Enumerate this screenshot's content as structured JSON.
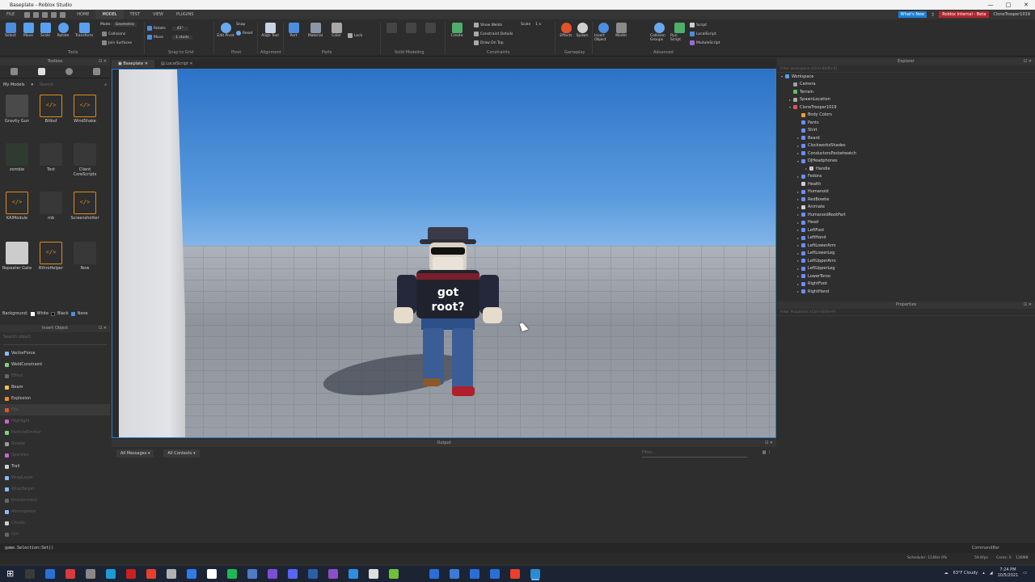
{
  "window": {
    "title": "Baseplate - Roblox Studio",
    "controls": [
      "—",
      "□",
      "✕"
    ]
  },
  "menubar": {
    "items": [
      "FILE",
      "HOME",
      "MODEL",
      "TEST",
      "VIEW",
      "PLUGINS"
    ],
    "active": "MODEL",
    "whats_new": "What's New",
    "internal_badge": "Roblox Internal - Beta",
    "user": "CloneTrooper1019"
  },
  "ribbon": {
    "tools": [
      "Select",
      "Move",
      "Scale",
      "Rotate",
      "Transform"
    ],
    "mode_label": "Mode:",
    "mode_value": "Geometric",
    "collisions": "Collisions",
    "join_surfaces": "Join Surfaces",
    "rotate_label": "Rotate",
    "rotate_value": "45°",
    "move_label": "Move",
    "move_value": "1 studs",
    "edit_pivot": "Edit Pivot",
    "snap_label": "Snap",
    "reset_label": "Reset",
    "align_tool": "Align Tool",
    "part": "Part",
    "material": "Material",
    "color": "Color",
    "lock": "Lock",
    "create": "Create",
    "show_welds": "Show Welds",
    "constraint_details": "Constraint Details",
    "draw_on_top": "Draw On Top",
    "scale_label": "Scale",
    "scale_value": "1 x",
    "effects": "Effects",
    "spawn": "Spawn",
    "insert_object": "Insert Object",
    "model": "Model",
    "collision_groups": "Collision Groups",
    "run_script": "Run Script",
    "script": "Script",
    "local_script": "LocalScript",
    "module_script": "ModuleScript",
    "groups": [
      "Tools",
      "Snap to Grid",
      "Pivot",
      "Alignment",
      "Parts",
      "Solid Modeling",
      "Constraints",
      "Gameplay",
      "Advanced"
    ]
  },
  "toolbox": {
    "title": "Toolbox",
    "category": "My Models",
    "search_placeholder": "Search",
    "items": [
      {
        "label": "Gravity Gun",
        "kind": "gun"
      },
      {
        "label": "Bitbuf",
        "kind": "script"
      },
      {
        "label": "WindShake",
        "kind": "script"
      },
      {
        "label": "zombie",
        "kind": "zombie"
      },
      {
        "label": "Test",
        "kind": "dark"
      },
      {
        "label": "Client CoreScripts",
        "kind": "dark"
      },
      {
        "label": "KAIModule",
        "kind": "script"
      },
      {
        "label": "mb",
        "kind": "dark"
      },
      {
        "label": "Screenshotter",
        "kind": "script"
      },
      {
        "label": "Repeater Gate",
        "kind": "gate"
      },
      {
        "label": "RthroHelper",
        "kind": "script"
      },
      {
        "label": "Now",
        "kind": "dark"
      }
    ],
    "background_label": "Background:",
    "background_options": [
      "White",
      "Black",
      "None"
    ]
  },
  "insert_object": {
    "title": "Insert Object",
    "search_placeholder": "Search object",
    "items": [
      {
        "label": "VectorForce",
        "color": "#8bb8ff",
        "dim": false,
        "sel": false
      },
      {
        "label": "WeldConstraint",
        "color": "#7fd07f",
        "dim": false,
        "sel": false
      },
      {
        "label": "Effect",
        "color": "#666666",
        "dim": true,
        "sel": false
      },
      {
        "label": "Beam",
        "color": "#f5c542",
        "dim": false,
        "sel": false
      },
      {
        "label": "Explosion",
        "color": "#f08a24",
        "dim": false,
        "sel": false
      },
      {
        "label": "Fire",
        "color": "#e0542b",
        "dim": true,
        "sel": true
      },
      {
        "label": "Highlight",
        "color": "#d05fd0",
        "dim": true,
        "sel": false
      },
      {
        "label": "ParticleEmitter",
        "color": "#7fd07f",
        "dim": true,
        "sel": false
      },
      {
        "label": "Smoke",
        "color": "#999999",
        "dim": true,
        "sel": false
      },
      {
        "label": "Sparkles",
        "color": "#d05fd0",
        "dim": true,
        "sel": false
      },
      {
        "label": "Trail",
        "color": "#cfcfcf",
        "dim": false,
        "sel": false
      },
      {
        "label": "WrapLayer",
        "color": "#8bb8ff",
        "dim": true,
        "sel": false
      },
      {
        "label": "WrapTarget",
        "color": "#8bb8ff",
        "dim": true,
        "sel": false
      },
      {
        "label": "Environment",
        "color": "#666666",
        "dim": true,
        "sel": false
      },
      {
        "label": "Atmosphere",
        "color": "#8bb8ff",
        "dim": true,
        "sel": false
      },
      {
        "label": "Clouds",
        "color": "#cfcfcf",
        "dim": true,
        "sel": false
      },
      {
        "label": "GUI",
        "color": "#666666",
        "dim": true,
        "sel": false
      }
    ]
  },
  "document_tabs": [
    "Baseplate",
    "LocalScript"
  ],
  "output": {
    "title": "Output",
    "filter_messages": "All Messages",
    "filter_contexts": "All Contexts",
    "filter_placeholder": "Filter..."
  },
  "explorer": {
    "title": "Explorer",
    "filter_placeholder": "Filter workspace (Ctrl+Shift+X)",
    "rows": [
      {
        "label": "Workspace",
        "depth": 0,
        "arrow": "▾",
        "color": "#4aa3ff"
      },
      {
        "label": "Camera",
        "depth": 1,
        "arrow": "",
        "color": "#9aa0a8"
      },
      {
        "label": "Terrain",
        "depth": 1,
        "arrow": "",
        "color": "#5fbf5f"
      },
      {
        "label": "SpawnLocation",
        "depth": 1,
        "arrow": "▸",
        "color": "#aaaaaa"
      },
      {
        "label": "CloneTrooper1019",
        "depth": 1,
        "arrow": "▾",
        "color": "#e05555"
      },
      {
        "label": "Body Colors",
        "depth": 2,
        "arrow": "",
        "color": "#f0a030"
      },
      {
        "label": "Pants",
        "depth": 2,
        "arrow": "",
        "color": "#6c8cff"
      },
      {
        "label": "Shirt",
        "depth": 2,
        "arrow": "",
        "color": "#6c8cff"
      },
      {
        "label": "Beard",
        "depth": 2,
        "arrow": "▸",
        "color": "#6c8cff"
      },
      {
        "label": "ClockworksShades",
        "depth": 2,
        "arrow": "▸",
        "color": "#6c8cff"
      },
      {
        "label": "ConductorsPocketwatch",
        "depth": 2,
        "arrow": "▸",
        "color": "#6c8cff"
      },
      {
        "label": "DJHeadphones",
        "depth": 2,
        "arrow": "▾",
        "color": "#6c8cff"
      },
      {
        "label": "Handle",
        "depth": 3,
        "arrow": "▸",
        "color": "#c8c8c8"
      },
      {
        "label": "Fedora",
        "depth": 2,
        "arrow": "▸",
        "color": "#6c8cff"
      },
      {
        "label": "Health",
        "depth": 2,
        "arrow": "",
        "color": "#cfcfcf"
      },
      {
        "label": "Humanoid",
        "depth": 2,
        "arrow": "▸",
        "color": "#6c8cff"
      },
      {
        "label": "RedBowtie",
        "depth": 2,
        "arrow": "▸",
        "color": "#6c8cff"
      },
      {
        "label": "Animate",
        "depth": 2,
        "arrow": "▸",
        "color": "#cfcfcf"
      },
      {
        "label": "HumanoidRootPart",
        "depth": 2,
        "arrow": "▸",
        "color": "#6c8cff"
      },
      {
        "label": "Head",
        "depth": 2,
        "arrow": "▸",
        "color": "#6c8cff"
      },
      {
        "label": "LeftFoot",
        "depth": 2,
        "arrow": "▸",
        "color": "#6c8cff"
      },
      {
        "label": "LeftHand",
        "depth": 2,
        "arrow": "▸",
        "color": "#6c8cff"
      },
      {
        "label": "LeftLowerArm",
        "depth": 2,
        "arrow": "▸",
        "color": "#6c8cff"
      },
      {
        "label": "LeftLowerLeg",
        "depth": 2,
        "arrow": "▸",
        "color": "#6c8cff"
      },
      {
        "label": "LeftUpperArm",
        "depth": 2,
        "arrow": "▸",
        "color": "#6c8cff"
      },
      {
        "label": "LeftUpperLeg",
        "depth": 2,
        "arrow": "▸",
        "color": "#6c8cff"
      },
      {
        "label": "LowerTorso",
        "depth": 2,
        "arrow": "▸",
        "color": "#6c8cff"
      },
      {
        "label": "RightFoot",
        "depth": 2,
        "arrow": "▸",
        "color": "#6c8cff"
      },
      {
        "label": "RightHand",
        "depth": 2,
        "arrow": "▸",
        "color": "#6c8cff"
      }
    ]
  },
  "properties": {
    "title": "Properties",
    "filter_placeholder": "Filter Properties (Ctrl+Shift+P)"
  },
  "command_bar": {
    "value": "game.Selection:Set()",
    "label": "CommandBar"
  },
  "status": {
    "scheduler": "Scheduler: 1146/s 0%",
    "fps": "59.6fps",
    "cores": "Cores: 0",
    "memory": "136MB"
  },
  "taskbar": {
    "weather": "63°F Cloudy",
    "time": "7:24 PM",
    "date": "10/5/2021",
    "apps": [
      "#3a3a3a",
      "#2a6fd6",
      "#d83b3b",
      "#888888",
      "#1f9ad6",
      "#c8211f",
      "#e8402c",
      "#b2b2b2",
      "#2f7be8",
      "#ffffff",
      "#1db954",
      "#4e7ac7",
      "#7a4fd6",
      "#5865f2",
      "#2c5fa8",
      "#8c4ec7",
      "#2f8de0",
      "#dddddd",
      "#6fbf3a",
      "#2a6fd6",
      "#3b7bd8",
      "#2a6fd6",
      "#2a6fd6",
      "#e8402c",
      "#2a8bd6"
    ]
  },
  "icons": {
    "start": "windows-logo-icon",
    "search": "search-icon",
    "task_view": "task-view-icon"
  }
}
